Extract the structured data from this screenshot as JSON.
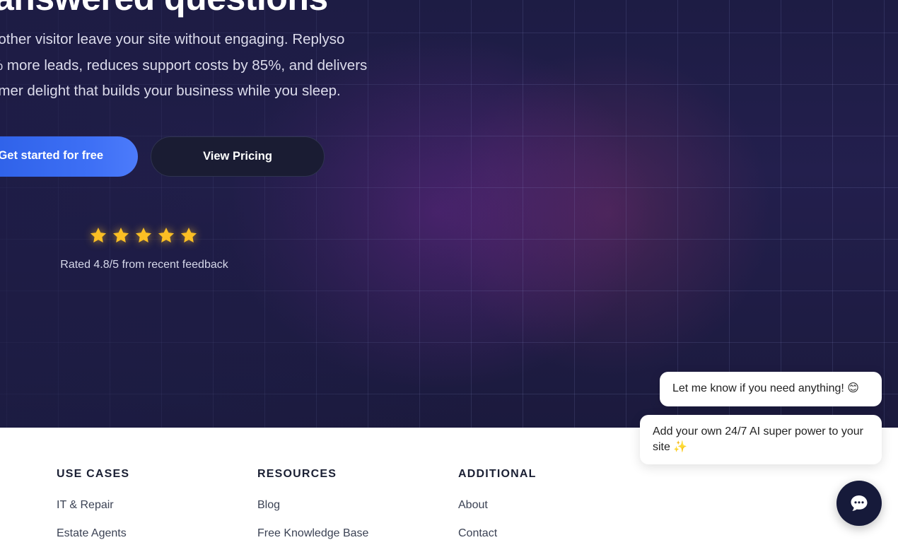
{
  "hero": {
    "headline": "answered questions",
    "subtext_lines": [
      "nother visitor leave your site without engaging. Replyso",
      "% more leads, reduces support costs by 85%, and delivers",
      "omer delight that builds your business while you sleep."
    ],
    "primary_cta": "Get started for free",
    "secondary_cta": "View Pricing",
    "rating": {
      "stars": 5,
      "text": "Rated 4.8/5 from recent feedback"
    }
  },
  "footer": {
    "columns": [
      {
        "heading": "USE CASES",
        "links": [
          "IT & Repair",
          "Estate Agents"
        ]
      },
      {
        "heading": "RESOURCES",
        "links": [
          "Blog",
          "Free Knowledge Base"
        ]
      },
      {
        "heading": "ADDITIONAL",
        "links": [
          "About",
          "Contact"
        ]
      }
    ]
  },
  "chat": {
    "messages": [
      "Let me know if you need anything! 😊",
      "Add your own 24/7 AI super power to your site ✨"
    ],
    "launcher_icon": "chat-bubble-icon"
  },
  "colors": {
    "primary": "#3d6ff5",
    "hero_bg": "#1d1c44",
    "star": "#fbbf24",
    "launcher": "#161a3a"
  }
}
